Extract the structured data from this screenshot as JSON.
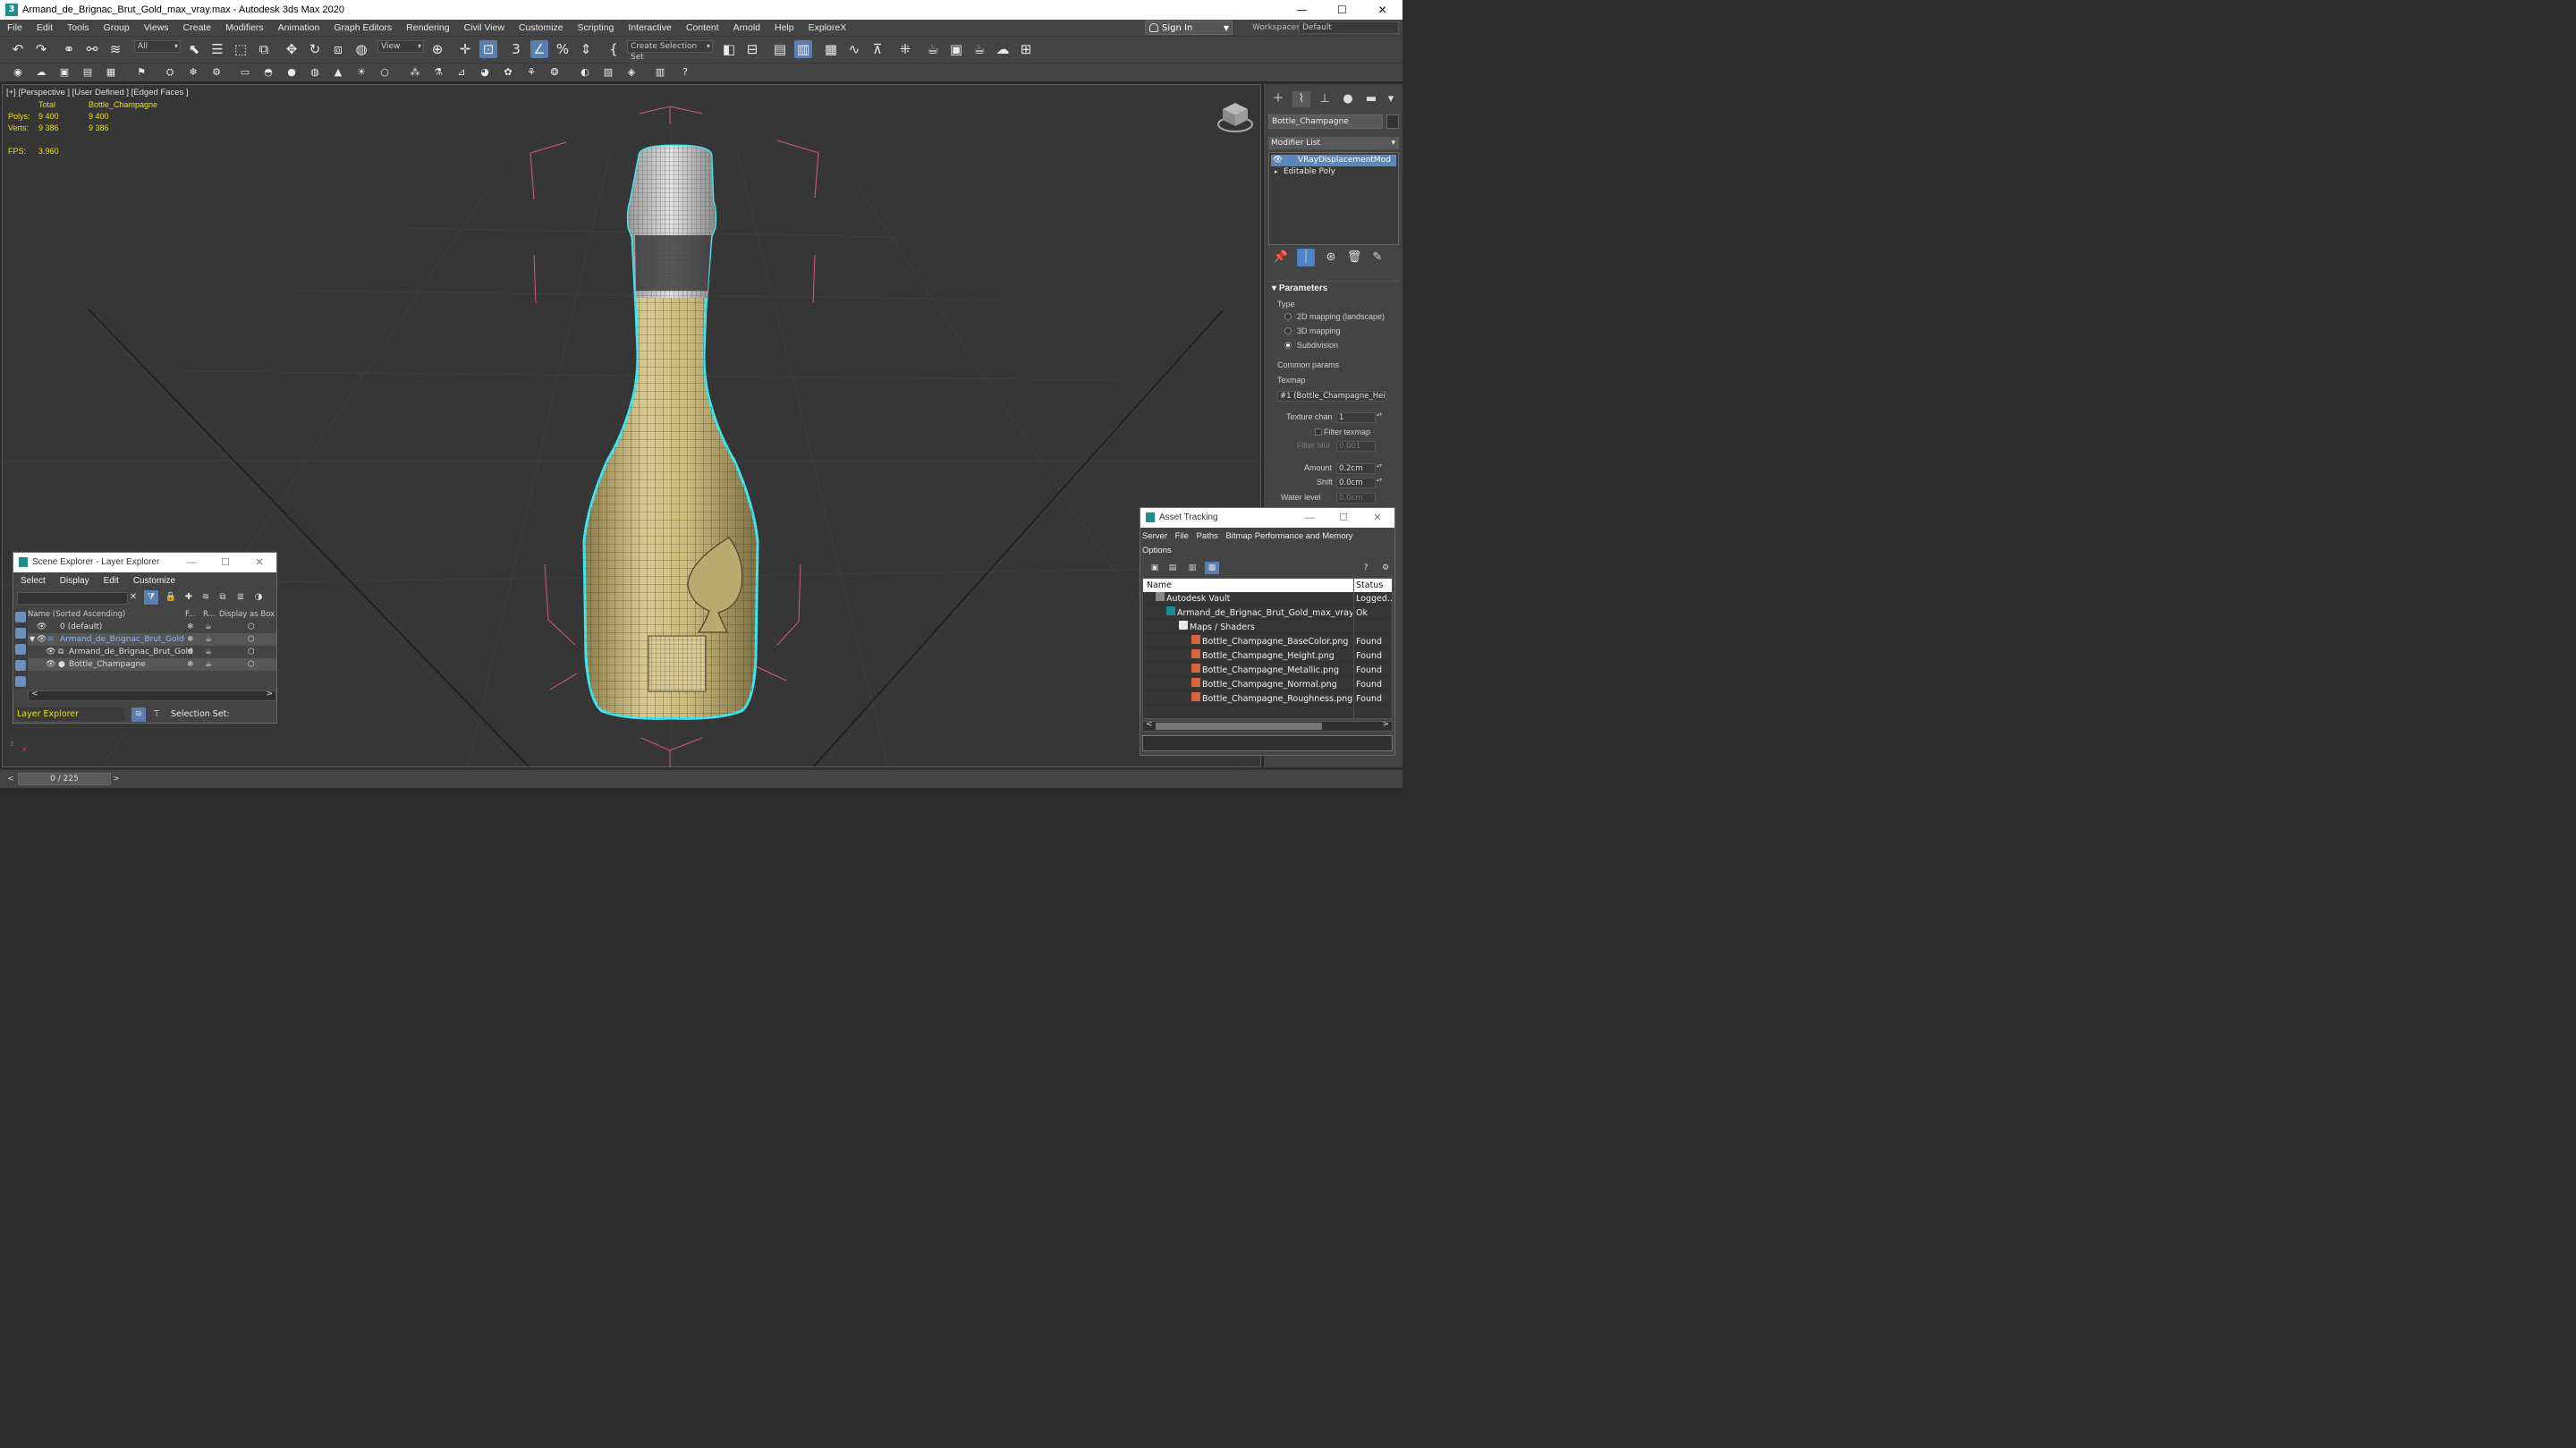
{
  "window": {
    "title": "Armand_de_Brignac_Brut_Gold_max_vray.max - Autodesk 3ds Max 2020",
    "app_icon": "3",
    "minimize": "—",
    "maximize": "☐",
    "close": "✕"
  },
  "menu": {
    "items": [
      "File",
      "Edit",
      "Tools",
      "Group",
      "Views",
      "Create",
      "Modifiers",
      "Animation",
      "Graph Editors",
      "Rendering",
      "Civil View",
      "Customize",
      "Scripting",
      "Interactive",
      "Content",
      "Arnold",
      "Help",
      "ExploreX"
    ],
    "sign_in": "Sign In",
    "workspaces_label": "Workspaces:",
    "workspace_value": "Default"
  },
  "toolbar": {
    "selection_filter": "All",
    "ref_coord": "View",
    "selection_set": "Create Selection Set"
  },
  "viewport": {
    "label": "[+] [Perspective ] [User Defined ] [Edged Faces ]",
    "stats": {
      "total_label": "Total",
      "object_label": "Bottle_Champagne",
      "polys_label": "Polys:",
      "polys_total": "9 400",
      "polys_object": "9 400",
      "verts_label": "Verts:",
      "verts_total": "9 386",
      "verts_object": "9 386",
      "fps_label": "FPS:",
      "fps_value": "3.960"
    },
    "axis_z": "z",
    "axis_x": "x"
  },
  "command_panel": {
    "object_name": "Bottle_Champagne",
    "modifier_list_label": "Modifier List",
    "stack": [
      {
        "label": "VRayDisplacementMod",
        "selected": true
      },
      {
        "label": "Editable Poly",
        "selected": false
      }
    ],
    "parameters": {
      "title": "Parameters",
      "type_label": "Type",
      "options": [
        {
          "label": "2D mapping (landscape)",
          "selected": false
        },
        {
          "label": "3D mapping",
          "selected": false
        },
        {
          "label": "Subdivision",
          "selected": true
        }
      ],
      "common_params": "Common params",
      "texmap_label": "Texmap",
      "texmap_value": "#1 (Bottle_Champagne_Height",
      "texture_chan_label": "Texture chan",
      "texture_chan_value": "1",
      "filter_texmap": "Filter texmap",
      "filter_blur_label": "Filter blur",
      "filter_blur_value": "0.001",
      "amount_label": "Amount",
      "amount_value": "0.2cm",
      "shift_label": "Shift",
      "shift_value": "0.0cm",
      "water_level_label": "Water level",
      "water_level_value": "0.0cm"
    }
  },
  "scene_explorer": {
    "title": "Scene Explorer - Layer Explorer",
    "menu": [
      "Select",
      "Display",
      "Edit",
      "Customize"
    ],
    "columns": {
      "name": "Name (Sorted Ascending)",
      "f": "F...",
      "r": "R...",
      "box": "Display as Box"
    },
    "rows": [
      {
        "name": "0 (default)",
        "indent": 0,
        "highlight": false
      },
      {
        "name": "Armand_de_Brignac_Brut_Gold",
        "indent": 0,
        "highlight": true
      },
      {
        "name": "Armand_de_Brignac_Brut_Gold",
        "indent": 1,
        "highlight": false
      },
      {
        "name": "Bottle_Champagne",
        "indent": 1,
        "highlight": true
      }
    ],
    "footer_explorer": "Layer Explorer",
    "footer_selection_set": "Selection Set:"
  },
  "asset_tracking": {
    "title": "Asset Tracking",
    "menu_line1": [
      "Server",
      "File",
      "Paths",
      "Bitmap Performance and Memory"
    ],
    "menu_line2": [
      "Options"
    ],
    "columns": {
      "name": "Name",
      "status": "Status"
    },
    "rows": [
      {
        "name": "Autodesk Vault",
        "status": "Logged...",
        "indent": 1,
        "icon": "vault"
      },
      {
        "name": "Armand_de_Brignac_Brut_Gold_max_vray.max",
        "status": "Ok",
        "indent": 2,
        "icon": "max"
      },
      {
        "name": "Maps / Shaders",
        "status": "",
        "indent": 3,
        "icon": "folder"
      },
      {
        "name": "Bottle_Champagne_BaseColor.png",
        "status": "Found",
        "indent": 4,
        "icon": "image"
      },
      {
        "name": "Bottle_Champagne_Height.png",
        "status": "Found",
        "indent": 4,
        "icon": "image"
      },
      {
        "name": "Bottle_Champagne_Metallic.png",
        "status": "Found",
        "indent": 4,
        "icon": "image"
      },
      {
        "name": "Bottle_Champagne_Normal.png",
        "status": "Found",
        "indent": 4,
        "icon": "image"
      },
      {
        "name": "Bottle_Champagne_Roughness.png",
        "status": "Found",
        "indent": 4,
        "icon": "image"
      }
    ]
  },
  "timeline": {
    "frame": "0 / 225",
    "prev": "<",
    "next": ">"
  },
  "colors": {
    "accent": "#5b86bd",
    "stats_yellow": "#f0e000",
    "selection_cyan": "#3fe6f0",
    "bottle_gold": "#c9b87a",
    "bbox_pink": "#d85a7a"
  }
}
